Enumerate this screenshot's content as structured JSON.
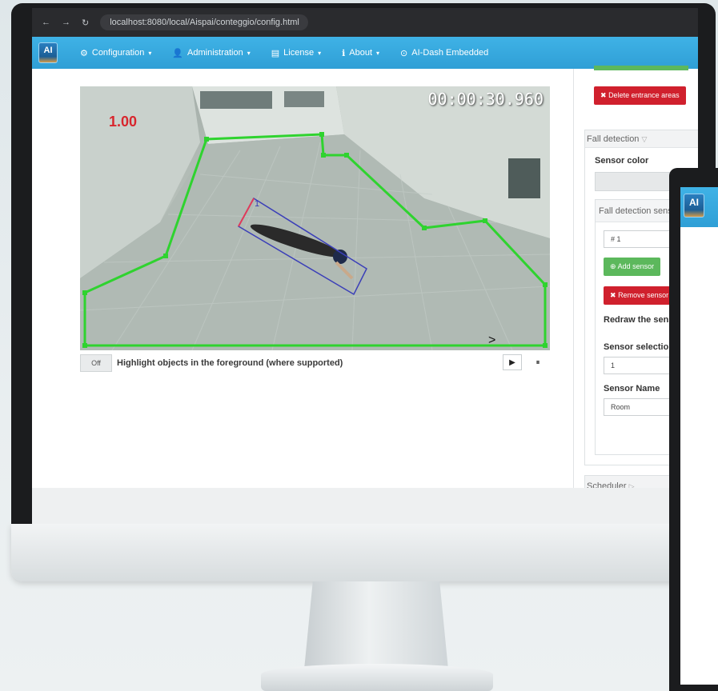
{
  "browser": {
    "url": "localhost:8080/local/Aispai/conteggio/config.html"
  },
  "navbar": {
    "logo": "AI",
    "items": [
      {
        "icon": "gear-icon",
        "label": "Configuration",
        "caret": "▾"
      },
      {
        "icon": "user-icon",
        "label": "Administration",
        "caret": "▾"
      },
      {
        "icon": "license-icon",
        "label": "License",
        "caret": "▾"
      },
      {
        "icon": "info-icon",
        "label": "About",
        "caret": "▾"
      },
      {
        "icon": "dash-icon",
        "label": "AI-Dash Embedded",
        "caret": ""
      }
    ]
  },
  "video": {
    "timecode": "00:00:30.960",
    "speed": "1.00",
    "sensor_number": "1",
    "next_marker": ">"
  },
  "controls": {
    "toggle": "Off",
    "highlight_label": "Highlight objects in the foreground (where supported)",
    "play": "▶",
    "pause": "⏸"
  },
  "right_panel": {
    "delete_entrance_areas": "Delete entrance areas",
    "fall_detection": {
      "heading": "Fall detection",
      "sensor_color_label": "Sensor color",
      "sensors_heading": "Fall detection sensors",
      "sensor_list_item": "# 1",
      "add_sensor": "Add sensor",
      "remove_sensor": "Remove sensor",
      "redraw_label": "Redraw the sensor",
      "selection_label": "Sensor selection",
      "selection_value": "1",
      "name_label": "Sensor Name",
      "name_value": "Room"
    },
    "scheduler_heading": "Scheduler"
  },
  "monitor2": {
    "logo": "AI"
  },
  "colors": {
    "navbar": "#3fb2e6",
    "polygon": "#2fd32f",
    "sensor_box": "#3b3fb8",
    "danger": "#d0202d",
    "success": "#5cb85c"
  }
}
